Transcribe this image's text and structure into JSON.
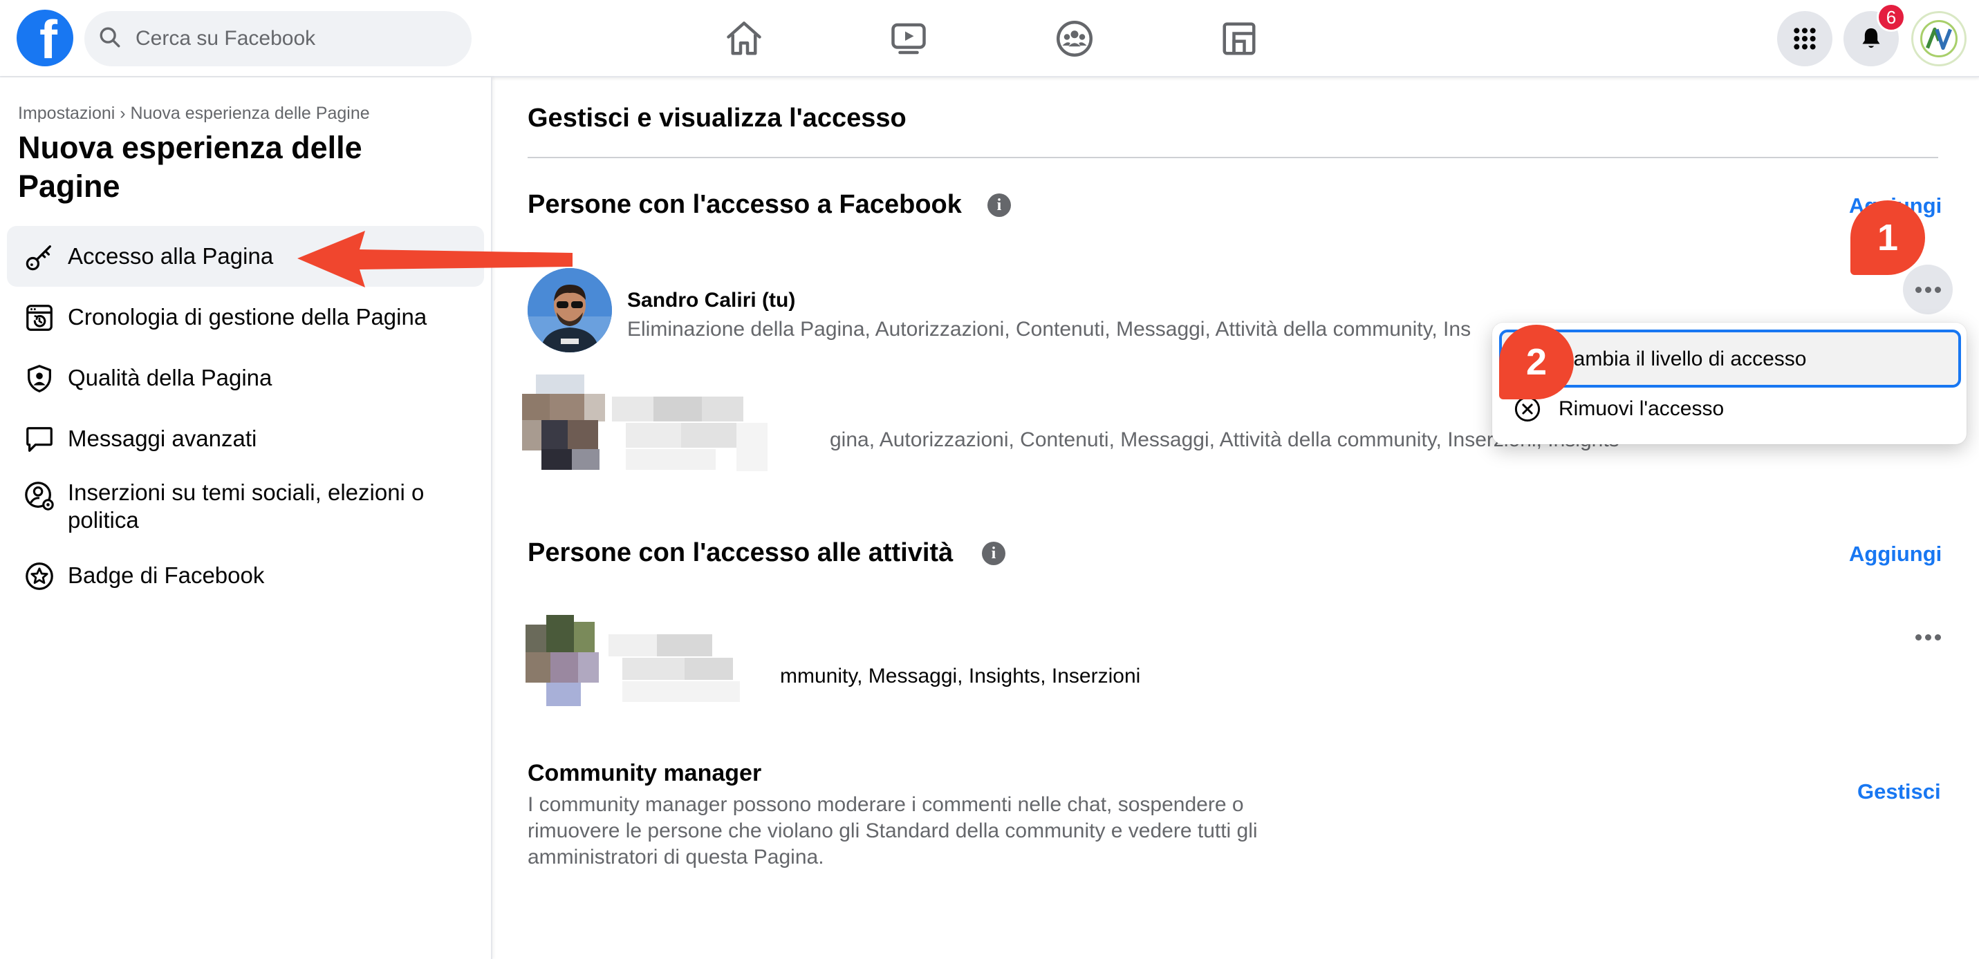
{
  "topbar": {
    "logo": "f",
    "search_placeholder": "Cerca su Facebook",
    "notification_count": "6"
  },
  "sidebar": {
    "breadcrumb": "Impostazioni › Nuova esperienza delle Pagine",
    "title": "Nuova esperienza delle Pagine",
    "items": [
      {
        "label": "Accesso alla Pagina",
        "icon": "key-icon",
        "active": true
      },
      {
        "label": "Cronologia di gestione della Pagina",
        "icon": "history-icon"
      },
      {
        "label": "Qualità della Pagina",
        "icon": "shield-icon"
      },
      {
        "label": "Messaggi avanzati",
        "icon": "message-icon"
      },
      {
        "label": "Inserzioni su temi sociali, elezioni o politica",
        "icon": "person-gear-icon"
      },
      {
        "label": "Badge di Facebook",
        "icon": "star-badge-icon"
      }
    ]
  },
  "main": {
    "title": "Gestisci e visualizza l'accesso",
    "facebook_access": {
      "title": "Persone con l'accesso a Facebook",
      "add_label": "Aggiungi",
      "people": [
        {
          "name": "Sandro Caliri (tu)",
          "roles": "Eliminazione della Pagina, Autorizzazioni, Contenuti, Messaggi, Attività della community, Ins"
        },
        {
          "name": "",
          "roles": "gina, Autorizzazioni, Contenuti, Messaggi, Attività della community, Inserzioni, Insights"
        }
      ]
    },
    "task_access": {
      "title": "Persone con l'accesso alle attività",
      "add_label": "Aggiungi",
      "people": [
        {
          "roles": "mmunity, Messaggi, Insights, Inserzioni"
        }
      ]
    },
    "community_manager": {
      "title": "Community manager",
      "description": "I community manager possono moderare i commenti nelle chat, sospendere o rimuovere le persone che violano gli Standard della community e vedere tutti gli amministratori di questa Pagina.",
      "manage_label": "Gestisci"
    }
  },
  "dropdown": {
    "items": [
      {
        "label": "Cambia il livello di accesso"
      },
      {
        "label": "Rimuovi l'accesso",
        "icon": "remove-circle-icon"
      }
    ]
  },
  "annotations": {
    "callout_1": "1",
    "callout_2": "2"
  },
  "colors": {
    "brand": "#1877f2",
    "annotation": "#f0462e",
    "badge": "#e41e3f"
  }
}
